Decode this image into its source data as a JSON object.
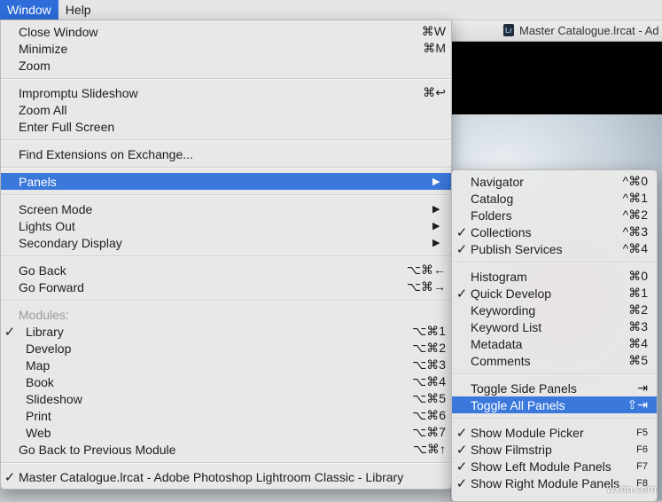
{
  "menubar": {
    "items": [
      {
        "label": "Window",
        "active": true
      },
      {
        "label": "Help",
        "active": false
      }
    ]
  },
  "background_window": {
    "title": "Master Catalogue.lrcat - Ad",
    "app_icon_text": "Lr"
  },
  "window_menu": {
    "items": [
      {
        "label": "Close Window",
        "shortcut": "⌘W"
      },
      {
        "label": "Minimize",
        "shortcut": "⌘M"
      },
      {
        "label": "Zoom",
        "shortcut": ""
      },
      {
        "separator": true
      },
      {
        "label": "Impromptu Slideshow",
        "shortcut": "⌘↩"
      },
      {
        "label": "Zoom All",
        "shortcut": ""
      },
      {
        "label": "Enter Full Screen",
        "shortcut": ""
      },
      {
        "separator": true
      },
      {
        "label": "Find Extensions on Exchange...",
        "shortcut": ""
      },
      {
        "separator": true
      },
      {
        "label": "Panels",
        "submenu": true,
        "highlighted": true
      },
      {
        "separator": true
      },
      {
        "label": "Screen Mode",
        "submenu": true
      },
      {
        "label": "Lights Out",
        "submenu": true
      },
      {
        "label": "Secondary Display",
        "submenu": true
      },
      {
        "separator": true
      },
      {
        "label": "Go Back",
        "shortcut": "⌥⌘←"
      },
      {
        "label": "Go Forward",
        "shortcut": "⌥⌘→"
      },
      {
        "separator": true
      },
      {
        "label": "Modules:",
        "disabled": true
      },
      {
        "label": "Library",
        "shortcut": "⌥⌘1",
        "checked": true,
        "indent": true
      },
      {
        "label": "Develop",
        "shortcut": "⌥⌘2",
        "indent": true
      },
      {
        "label": "Map",
        "shortcut": "⌥⌘3",
        "indent": true
      },
      {
        "label": "Book",
        "shortcut": "⌥⌘4",
        "indent": true
      },
      {
        "label": "Slideshow",
        "shortcut": "⌥⌘5",
        "indent": true
      },
      {
        "label": "Print",
        "shortcut": "⌥⌘6",
        "indent": true
      },
      {
        "label": "Web",
        "shortcut": "⌥⌘7",
        "indent": true
      },
      {
        "label": "Go Back to Previous Module",
        "shortcut": "⌥⌘↑"
      },
      {
        "separator": true
      },
      {
        "label": "Master Catalogue.lrcat - Adobe Photoshop Lightroom Classic - Library",
        "checked": true
      }
    ]
  },
  "panels_menu": {
    "items": [
      {
        "label": "Navigator",
        "shortcut": "^⌘0"
      },
      {
        "label": "Catalog",
        "shortcut": "^⌘1"
      },
      {
        "label": "Folders",
        "shortcut": "^⌘2"
      },
      {
        "label": "Collections",
        "shortcut": "^⌘3",
        "checked": true
      },
      {
        "label": "Publish Services",
        "shortcut": "^⌘4",
        "checked": true
      },
      {
        "separator": true
      },
      {
        "label": "Histogram",
        "shortcut": "⌘0"
      },
      {
        "label": "Quick Develop",
        "shortcut": "⌘1",
        "checked": true
      },
      {
        "label": "Keywording",
        "shortcut": "⌘2"
      },
      {
        "label": "Keyword List",
        "shortcut": "⌘3"
      },
      {
        "label": "Metadata",
        "shortcut": "⌘4"
      },
      {
        "label": "Comments",
        "shortcut": "⌘5"
      },
      {
        "separator": true
      },
      {
        "label": "Toggle Side Panels",
        "shortcut": "⇥"
      },
      {
        "label": "Toggle All Panels",
        "shortcut": "⇧⇥",
        "highlighted": true
      },
      {
        "separator": true
      },
      {
        "label": "Show Module Picker",
        "shortcut": "F5",
        "checked": true,
        "small": true
      },
      {
        "label": "Show Filmstrip",
        "shortcut": "F6",
        "checked": true,
        "small": true
      },
      {
        "label": "Show Left Module Panels",
        "shortcut": "F7",
        "checked": true,
        "small": true
      },
      {
        "label": "Show Right Module Panels",
        "shortcut": "F8",
        "checked": true,
        "small": true
      }
    ]
  },
  "watermark": "wxdn.com",
  "colors": {
    "highlight": "#3b78dc",
    "menu_bg": "#e8e8e8",
    "active_menubar": "#2d6cd9"
  }
}
